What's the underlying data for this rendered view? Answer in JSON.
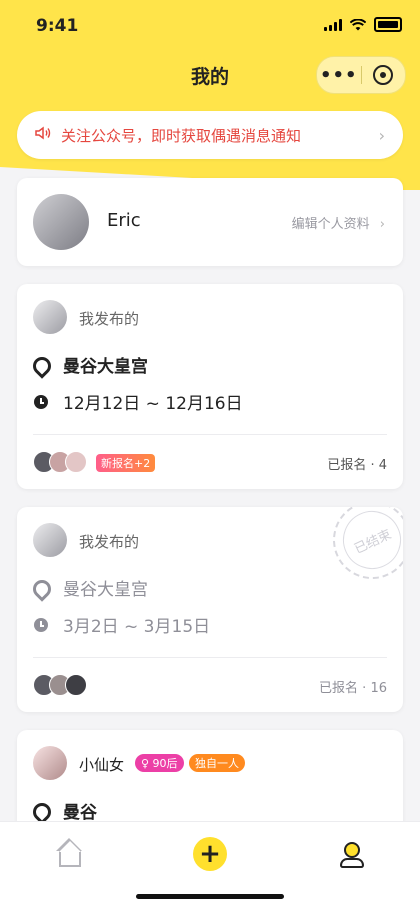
{
  "status": {
    "time": "9:41"
  },
  "header": {
    "title": "我的",
    "capsule_more": "•••"
  },
  "notice": {
    "text": "关注公众号，即时获取偶遇消息通知"
  },
  "profile": {
    "name": "Eric",
    "edit_label": "编辑个人资料"
  },
  "posts": [
    {
      "author_label": "我发布的",
      "location": "曼谷大皇宫",
      "dates": "12月12日 ~ 12月16日",
      "new_badge": "新报名+2",
      "registered": "已报名 · 4",
      "ended": false
    },
    {
      "author_label": "我发布的",
      "location": "曼谷大皇宫",
      "dates": "3月2日 ~ 3月15日",
      "registered": "已报名 · 16",
      "ended": true,
      "stamp": "已结束"
    },
    {
      "author_name": "小仙女",
      "age_tag": "♀ 90后",
      "solo_tag": "独自一人",
      "location": "曼谷"
    }
  ],
  "colors": {
    "brand_yellow": "#ffe44a",
    "notice_red": "#e5473f",
    "new_badge": "#ff5e8a",
    "age_tag": "#ec3fa6",
    "solo_tag": "#ff8a1f"
  },
  "tabs": [
    {
      "name": "home",
      "icon": "home-icon"
    },
    {
      "name": "publish",
      "icon": "plus-icon",
      "label": "+"
    },
    {
      "name": "me",
      "icon": "user-icon"
    }
  ]
}
